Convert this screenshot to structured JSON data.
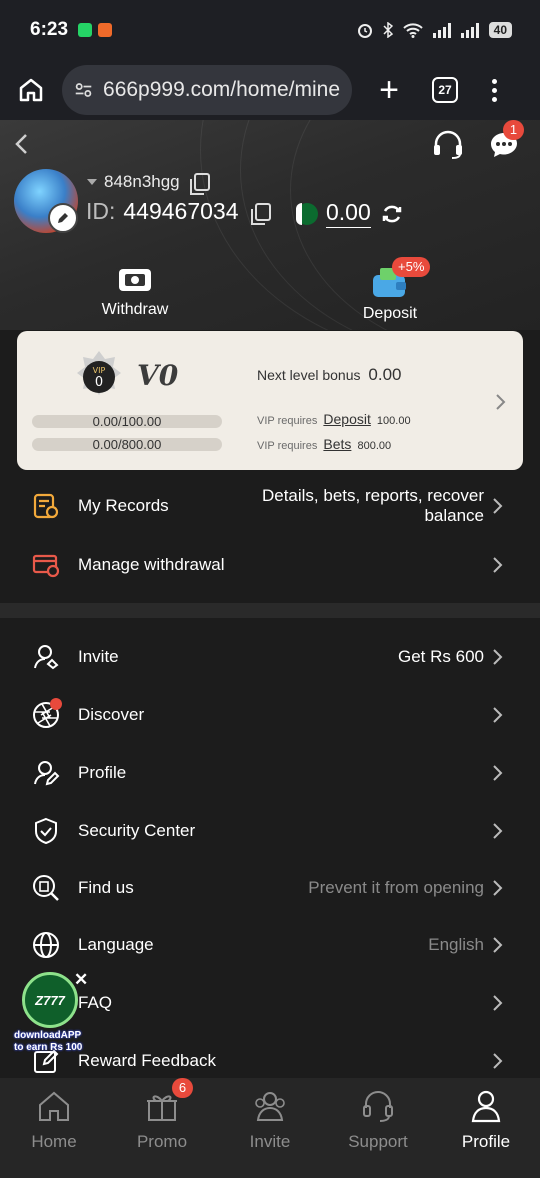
{
  "status_bar": {
    "time": "6:23",
    "battery": "40"
  },
  "browser": {
    "url": "666p999.com/home/mine",
    "tab_count": "27"
  },
  "header": {
    "chat_badge": "1",
    "username": "848n3hgg",
    "id_label": "ID:",
    "id_value": "449467034",
    "balance": "0.00"
  },
  "actions": {
    "withdraw": "Withdraw",
    "deposit": "Deposit",
    "deposit_badge": "+5%"
  },
  "vip": {
    "level": "V0",
    "medal_text": "VIP",
    "medal_num": "0",
    "progress_1": "0.00/100.00",
    "progress_2": "0.00/800.00",
    "next_bonus_label": "Next level bonus",
    "next_bonus_value": "0.00",
    "req_prefix": "VIP requires",
    "req_deposit_link": "Deposit",
    "req_deposit_amount": "100.00",
    "req_bets_link": "Bets",
    "req_bets_amount": "800.00"
  },
  "menu_top": [
    {
      "label": "My Records",
      "value_line1": "Details, bets, reports, recover",
      "value_line2": "balance"
    },
    {
      "label": "Manage withdrawal",
      "value_line1": "",
      "value_line2": ""
    }
  ],
  "menu": [
    {
      "label": "Invite",
      "value": "Get Rs 600"
    },
    {
      "label": "Discover",
      "value": ""
    },
    {
      "label": "Profile",
      "value": ""
    },
    {
      "label": "Security Center",
      "value": ""
    },
    {
      "label": "Find us",
      "value": "Prevent it from opening"
    },
    {
      "label": "Language",
      "value": "English"
    },
    {
      "label": "FAQ",
      "value": ""
    },
    {
      "label": "Reward Feedback",
      "value": ""
    }
  ],
  "float_promo": {
    "logo": "Z777",
    "line1": "downloadAPP",
    "line2": "to earn Rs 100"
  },
  "bottom_nav": {
    "home": "Home",
    "promo": "Promo",
    "promo_badge": "6",
    "invite": "Invite",
    "support": "Support",
    "profile": "Profile"
  },
  "colors": {
    "accent_red": "#e84a3c",
    "card_bg": "#f1ede6",
    "page_bg": "#1c1c1c"
  }
}
